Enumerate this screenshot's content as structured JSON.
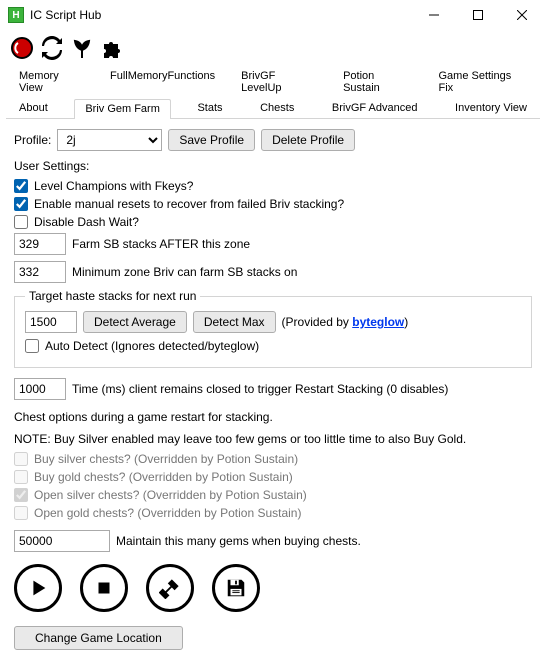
{
  "window": {
    "title": "IC Script Hub"
  },
  "tabs": {
    "row1": [
      "Memory View",
      "FullMemoryFunctions",
      "BrivGF LevelUp",
      "Potion Sustain",
      "Game Settings Fix"
    ],
    "row2": [
      "About",
      "Briv Gem Farm",
      "Stats",
      "Chests",
      "BrivGF Advanced",
      "Inventory View"
    ],
    "active": "Briv Gem Farm"
  },
  "profile": {
    "label": "Profile:",
    "value": "2j",
    "save": "Save Profile",
    "delete": "Delete Profile"
  },
  "userSettings": {
    "heading": "User Settings:",
    "levelFkeys": {
      "label": "Level Champions with Fkeys?",
      "checked": true
    },
    "manualResets": {
      "label": "Enable manual resets to recover from failed Briv stacking?",
      "checked": true
    },
    "disableDash": {
      "label": "Disable Dash Wait?",
      "checked": false
    },
    "farmAfter": {
      "value": "329",
      "label": "Farm SB stacks AFTER this zone"
    },
    "minZone": {
      "value": "332",
      "label": "Minimum zone Briv can farm SB stacks on"
    }
  },
  "haste": {
    "legend": "Target haste stacks for next run",
    "value": "1500",
    "detectAvg": "Detect Average",
    "detectMax": "Detect Max",
    "providedBy": "(Provided by ",
    "providerName": "byteglow",
    "providedByEnd": ")",
    "autoDetect": {
      "label": "Auto Detect (Ignores detected/byteglow)",
      "checked": false
    }
  },
  "restart": {
    "value": "1000",
    "label": "Time (ms) client remains closed to trigger Restart Stacking (0 disables)"
  },
  "chests": {
    "heading": "Chest options during a game restart for stacking.",
    "note": "NOTE: Buy Silver enabled may leave too few gems or too little time to also Buy Gold.",
    "buySilver": {
      "label": "Buy silver chests? (Overridden by Potion Sustain)",
      "checked": false
    },
    "buyGold": {
      "label": "Buy gold chests? (Overridden by Potion Sustain)",
      "checked": false
    },
    "openSilver": {
      "label": "Open silver chests? (Overridden by Potion Sustain)",
      "checked": true
    },
    "openGold": {
      "label": "Open gold chests? (Overridden by Potion Sustain)",
      "checked": false
    }
  },
  "gems": {
    "value": "50000",
    "label": "Maintain this many gems when buying chests."
  },
  "footer": {
    "changeLoc": "Change Game Location"
  }
}
